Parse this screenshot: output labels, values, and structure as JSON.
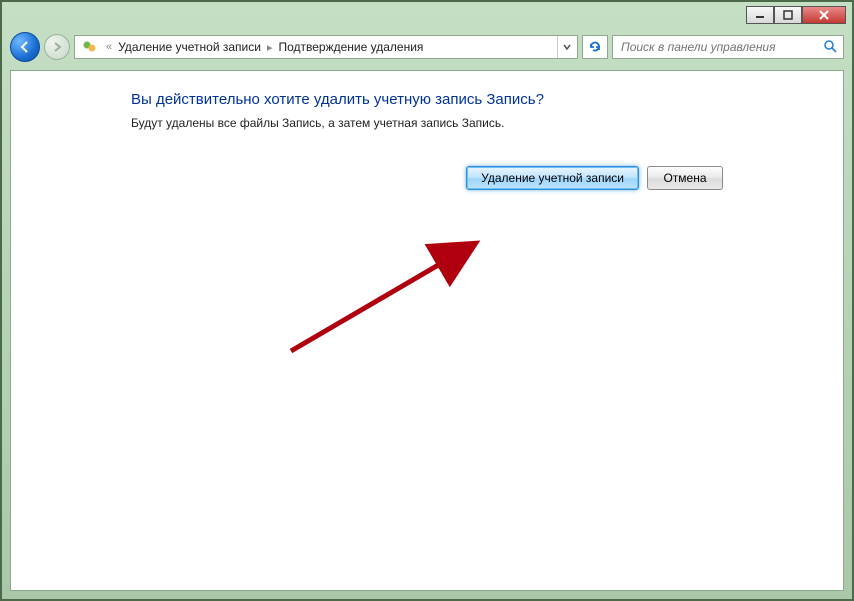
{
  "titlebar": {
    "minimize": "—",
    "maximize": "☐",
    "close": "X"
  },
  "breadcrumb": {
    "overflow": "«",
    "seg1": "Удаление учетной записи",
    "sep": "▸",
    "seg2": "Подтверждение удаления"
  },
  "search": {
    "placeholder": "Поиск в панели управления"
  },
  "main": {
    "heading": "Вы действительно хотите удалить учетную запись Запись?",
    "body": "Будут удалены все файлы Запись, а затем учетная запись Запись.",
    "btn_delete": "Удаление учетной записи",
    "btn_cancel": "Отмена"
  }
}
